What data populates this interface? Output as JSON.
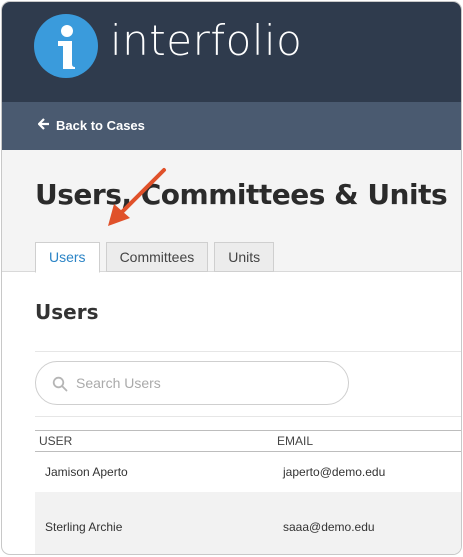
{
  "header": {
    "brand": "interfolio",
    "logo_letter": "i"
  },
  "nav": {
    "back_label": "Back to Cases",
    "back_icon": "arrow-left-icon"
  },
  "page": {
    "title": "Users, Committees & Units",
    "tabs": [
      {
        "label": "Users",
        "active": true
      },
      {
        "label": "Committees",
        "active": false
      },
      {
        "label": "Units",
        "active": false
      }
    ]
  },
  "section": {
    "title": "Users"
  },
  "search": {
    "placeholder": "Search Users",
    "value": "",
    "icon": "search-icon"
  },
  "table": {
    "columns": [
      "USER",
      "EMAIL"
    ],
    "rows": [
      {
        "user": "Jamison Aperto",
        "email": "japerto@demo.edu"
      },
      {
        "user": "Sterling Archie",
        "email": "saaa@demo.edu"
      }
    ]
  },
  "colors": {
    "topbar": "#2f3b4d",
    "subbar": "#4a5a70",
    "logo": "#3a9bdc",
    "active_tab_text": "#2b84c6",
    "annotation_arrow": "#e0512a"
  }
}
